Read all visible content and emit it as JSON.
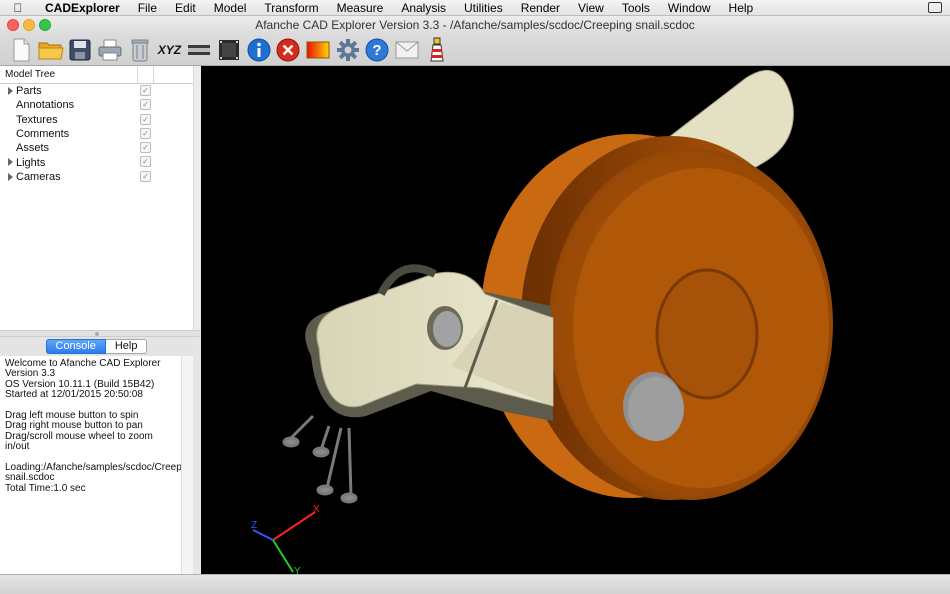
{
  "menubar": {
    "app_name": "CADExplorer",
    "items": [
      "File",
      "Edit",
      "Model",
      "Transform",
      "Measure",
      "Analysis",
      "Utilities",
      "Render",
      "View",
      "Tools",
      "Window",
      "Help"
    ]
  },
  "window": {
    "title": "Afanche CAD Explorer Version 3.3 - /Afanche/samples/scdoc/Creeping snail.scdoc"
  },
  "toolbar": {
    "xyz_label": "XYZ",
    "icons": [
      "new-document-icon",
      "open-folder-icon",
      "save-icon",
      "print-icon",
      "trash-icon",
      "xyz-axes-icon",
      "ruler-icon",
      "film-icon",
      "info-icon",
      "stop-icon",
      "color-gradient-icon",
      "gear-icon",
      "help-icon",
      "mail-icon",
      "lighthouse-icon"
    ]
  },
  "model_tree": {
    "header": "Model Tree",
    "items": [
      {
        "label": "Parts",
        "expandable": true,
        "checked": true
      },
      {
        "label": "Annotations",
        "expandable": false,
        "checked": true
      },
      {
        "label": "Textures",
        "expandable": false,
        "checked": true
      },
      {
        "label": "Comments",
        "expandable": false,
        "checked": true
      },
      {
        "label": "Assets",
        "expandable": false,
        "checked": true
      },
      {
        "label": "Lights",
        "expandable": true,
        "checked": true
      },
      {
        "label": "Cameras",
        "expandable": true,
        "checked": true
      }
    ]
  },
  "tabs": {
    "console": "Console",
    "help": "Help",
    "active": "Console"
  },
  "console": {
    "lines": [
      "Welcome to Afanche CAD Explorer Version 3.3",
      "OS Version 10.11.1 (Build 15B42)",
      "Started at 12/01/2015 20:50:08",
      "",
      "Drag left mouse button to spin",
      "Drag right mouse button to pan",
      "Drag/scroll mouse wheel to zoom in/out",
      "",
      "Loading:/Afanche/samples/scdoc/Creeping snail.scdoc",
      "Total Time:1.0 sec"
    ]
  },
  "axes": {
    "x_label": "X",
    "y_label": "Y",
    "z_label": "Z",
    "x_color": "#ff2020",
    "y_color": "#22cc22",
    "z_color": "#3355ff"
  },
  "colors": {
    "wheel": "#b85a0a",
    "arm": "#e6e2c8",
    "viewport_bg": "#000000",
    "selected_tab": "#2b7cf0"
  }
}
